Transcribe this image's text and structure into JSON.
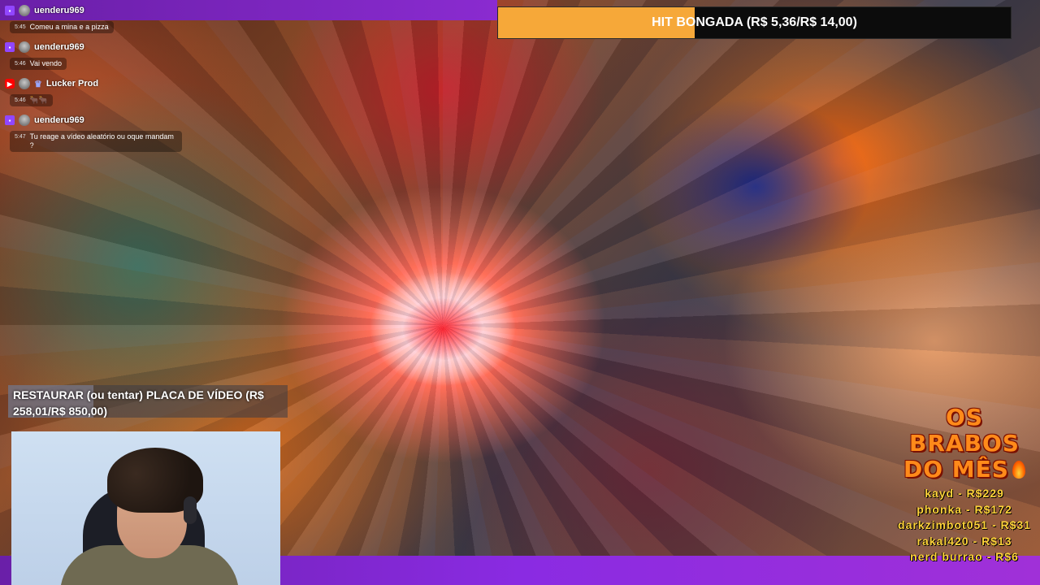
{
  "chat": {
    "messages": [
      {
        "platform": "twitch",
        "platform_icon": "twitch-icon",
        "user": "uenderu969",
        "badge": "",
        "time": "5:45",
        "text": "Comeu a mina e a pizza"
      },
      {
        "platform": "twitch",
        "platform_icon": "twitch-icon",
        "user": "uenderu969",
        "badge": "",
        "time": "5:46",
        "text": "Vai vendo"
      },
      {
        "platform": "youtube",
        "platform_icon": "youtube-icon",
        "user": "Lucker Prod",
        "badge": "crown-icon",
        "time": "5:46",
        "text": "🐂🐂"
      },
      {
        "platform": "twitch",
        "platform_icon": "twitch-icon",
        "user": "uenderu969",
        "badge": "",
        "time": "5:47",
        "text": "Tu reage a vídeo aleatório ou oque mandam ?"
      }
    ]
  },
  "goal_top": {
    "label": "HIT BONGADA (R$ 5,36/R$ 14,00)",
    "progress": 0.383,
    "color": "#f6a839"
  },
  "goal_mid": {
    "label": "RESTAURAR (ou tentar) PLACA DE VÍDEO (R$ 258,01/R$ 850,00)",
    "progress": 0.304
  },
  "leaderboard": {
    "title_line1": "OS",
    "title_line2": "BRABOS",
    "title_line3": "DO MÊS",
    "icon": "fire-icon",
    "entries": [
      "kayd - R$229",
      "phonka - R$172",
      "darkzimbot051 - R$31",
      "rakal420 - R$13",
      "nerd burrao - R$6"
    ]
  },
  "colors": {
    "brand_purple": "#8a2be2",
    "goal_orange": "#f6a839",
    "leader_yellow": "#ffd33a"
  }
}
